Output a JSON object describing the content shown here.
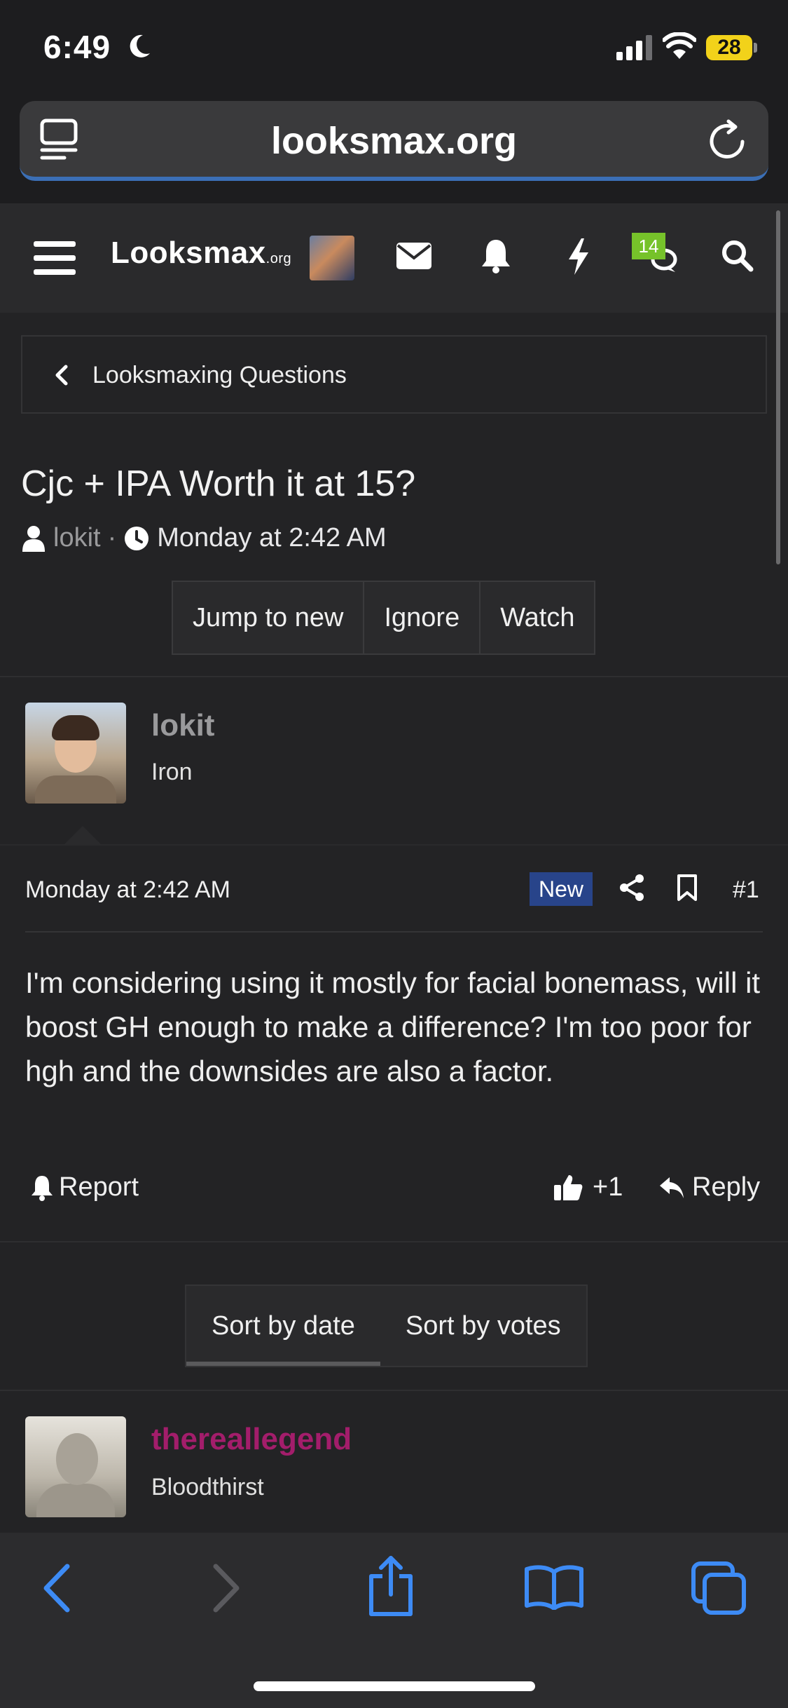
{
  "status_bar": {
    "time": "6:49",
    "battery": "28"
  },
  "browser": {
    "url": "looksmax.org"
  },
  "header": {
    "logo": "Looksmax",
    "logo_suffix": ".org",
    "chat_badge": "14"
  },
  "breadcrumb": {
    "label": "Looksmaxing Questions"
  },
  "thread": {
    "title": "Cjc + IPA Worth it at 15?",
    "author": "lokit",
    "separator": "·",
    "date": "Monday at 2:42 AM",
    "buttons": [
      "Jump to new",
      "Ignore",
      "Watch"
    ]
  },
  "post": {
    "username": "lokit",
    "rank": "Iron",
    "date": "Monday at 2:42 AM",
    "new_badge": "New",
    "number": "#1",
    "body": "I'm considering using it mostly for facial bonemass, will it boost GH enough to make a difference? I'm too poor for hgh and the downsides are also a factor.",
    "report_label": "Report",
    "like_count": "+1",
    "reply_label": "Reply"
  },
  "sort": {
    "by_date": "Sort by date",
    "by_votes": "Sort by votes"
  },
  "reply_post": {
    "username": "thereallegend",
    "rank": "Bloodthirst"
  },
  "colors": {
    "accent_blue": "#3b6fb6",
    "badge_green": "#76c22a",
    "new_badge": "#28448a",
    "reply_username": "#a31d6b"
  }
}
